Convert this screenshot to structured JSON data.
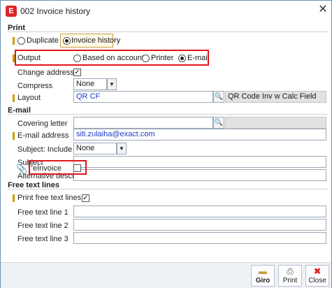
{
  "window": {
    "title": "002 Invoice history",
    "app_icon_text": "E",
    "close_glyph": "✕"
  },
  "print": {
    "section_title": "Print",
    "tabs": [
      {
        "label": "Duplicate",
        "selected": false
      },
      {
        "label": "Invoice history",
        "selected": true
      }
    ],
    "output": {
      "label": "Output",
      "options": [
        {
          "label": "Based on account",
          "selected": false
        },
        {
          "label": "Printer",
          "selected": false
        },
        {
          "label": "E-mail",
          "selected": true
        }
      ]
    },
    "change_address": {
      "label": "Change address",
      "checked": true,
      "check_glyph": "✓"
    },
    "compress": {
      "label": "Compress",
      "value": "None"
    },
    "layout": {
      "label": "Layout",
      "value": "QR CF",
      "description": "QR Code Inv w Calc Field"
    }
  },
  "email": {
    "section_title": "E-mail",
    "covering_letter": {
      "label": "Covering letter",
      "value": ""
    },
    "email_address": {
      "label": "E-mail address",
      "value": "siti.zulaiha@exact.com"
    },
    "subject_include": {
      "label": "Subject: Include",
      "value": "None"
    },
    "subject": {
      "label": "Subject",
      "value": ""
    },
    "alternative_descr": {
      "label": "Alternative descr.",
      "value": ""
    },
    "einvoice": {
      "label": "eInvoice",
      "checked": false
    }
  },
  "free_text": {
    "section_title": "Free text lines",
    "print_free_text": {
      "label": "Print free text lines",
      "checked": true,
      "check_glyph": "✓"
    },
    "lines": [
      {
        "label": "Free text line 1",
        "value": ""
      },
      {
        "label": "Free text line 2",
        "value": ""
      },
      {
        "label": "Free text line 3",
        "value": ""
      }
    ]
  },
  "buttons": [
    {
      "label": "Giro",
      "icon": "giro-icon"
    },
    {
      "label": "Print",
      "icon": "printer-icon"
    },
    {
      "label": "Close",
      "icon": "close-icon"
    }
  ],
  "colors": {
    "highlight_red": "#e3141b",
    "link_blue": "#1d3cc6",
    "required_marker": "#c8a000"
  }
}
